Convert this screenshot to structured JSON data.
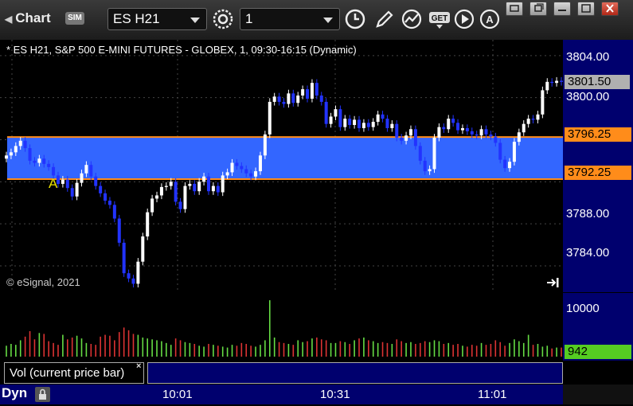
{
  "window": {
    "title": "Chart",
    "sim_badge": "SIM",
    "symbol": "ES H21",
    "interval": "1"
  },
  "chart": {
    "title": "* ES H21, S&P 500 E-MINI FUTURES - GLOBEX, 1, 09:30-16:15 (Dynamic)",
    "copyright": "© eSignal, 2021",
    "annotation": "A",
    "price_ticks": [
      "3804.00",
      "3800.00",
      "3788.00",
      "3784.00"
    ],
    "last_price": "3801.50",
    "upper_line": "3796.25",
    "lower_line": "3792.25",
    "vol_tick": "10000",
    "last_volume": "942",
    "study_label": "Vol (current price bar)",
    "close_study": "×",
    "time_ticks": [
      "10:01",
      "10:31",
      "11:01"
    ],
    "mode_label": "Dyn"
  },
  "colors": {
    "zone": "#3366ff",
    "line": "#ff8c1a",
    "up": "#ffffff",
    "down": "#2233ff",
    "vol_up": "#66dd44",
    "vol_down": "#dd3333",
    "axis_bg": "#00006e"
  },
  "chart_data": {
    "type": "candlestick",
    "ylim": [
      3781.5,
      3805.5
    ],
    "zone": [
      3792.25,
      3796.25
    ],
    "closes": [
      3794.5,
      3794.8,
      3795.4,
      3795.9,
      3795.2,
      3794.0,
      3793.8,
      3794.2,
      3793.7,
      3793.4,
      3792.6,
      3791.8,
      3792.2,
      3791.4,
      3790.6,
      3791.9,
      3792.8,
      3793.6,
      3792.5,
      3791.6,
      3790.9,
      3790.2,
      3789.8,
      3788.5,
      3786.2,
      3783.3,
      3782.8,
      3782.3,
      3784.4,
      3786.8,
      3789.1,
      3790.4,
      3790.7,
      3791.5,
      3791.6,
      3792.0,
      3790.1,
      3789.4,
      3791.6,
      3791.8,
      3791.1,
      3792.0,
      3792.5,
      3791.1,
      3791.6,
      3791.0,
      3792.6,
      3792.9,
      3793.8,
      3793.5,
      3793.2,
      3792.8,
      3792.5,
      3793.0,
      3794.5,
      3796.5,
      3799.6,
      3800.1,
      3799.6,
      3799.4,
      3800.4,
      3799.5,
      3800.2,
      3800.8,
      3799.9,
      3801.4,
      3800.2,
      3799.6,
      3797.5,
      3798.2,
      3798.9,
      3797.2,
      3798.0,
      3797.4,
      3797.9,
      3797.1,
      3797.6,
      3797.2,
      3797.7,
      3798.4,
      3798.0,
      3797.1,
      3797.5,
      3796.2,
      3795.9,
      3796.4,
      3797.0,
      3795.4,
      3794.0,
      3793.0,
      3793.2,
      3796.2,
      3797.2,
      3797.0,
      3798.0,
      3797.6,
      3796.9,
      3797.1,
      3796.8,
      3796.5,
      3796.4,
      3797.0,
      3796.5,
      3796.3,
      3795.7,
      3794.1,
      3793.3,
      3793.9,
      3795.8,
      3796.7,
      3797.5,
      3798.0,
      3797.9,
      3798.4,
      3800.7,
      3801.5,
      3801.4,
      3801.6,
      3801.5
    ],
    "volume": [
      120,
      140,
      130,
      180,
      220,
      280,
      190,
      260,
      250,
      170,
      150,
      130,
      240,
      190,
      210,
      230,
      200,
      150,
      140,
      130,
      220,
      240,
      230,
      180,
      270,
      320,
      290,
      250,
      240,
      210,
      200,
      190,
      180,
      170,
      150,
      130,
      200,
      180,
      160,
      150,
      140,
      120,
      110,
      140,
      130,
      120,
      110,
      100,
      130,
      120,
      150,
      140,
      120,
      110,
      130,
      180,
      620,
      210,
      160,
      150,
      140,
      130,
      180,
      160,
      170,
      200,
      210,
      190,
      180,
      150,
      150,
      170,
      160,
      140,
      180,
      200,
      210,
      180,
      170,
      150,
      160,
      150,
      140,
      190,
      170,
      150,
      160,
      140,
      150,
      170,
      160,
      180,
      170,
      140,
      150,
      130,
      140,
      120,
      110,
      130,
      120,
      150,
      130,
      140,
      180,
      160,
      120,
      150,
      190,
      170,
      150,
      240,
      130,
      140,
      110,
      120,
      90,
      100,
      100
    ]
  }
}
